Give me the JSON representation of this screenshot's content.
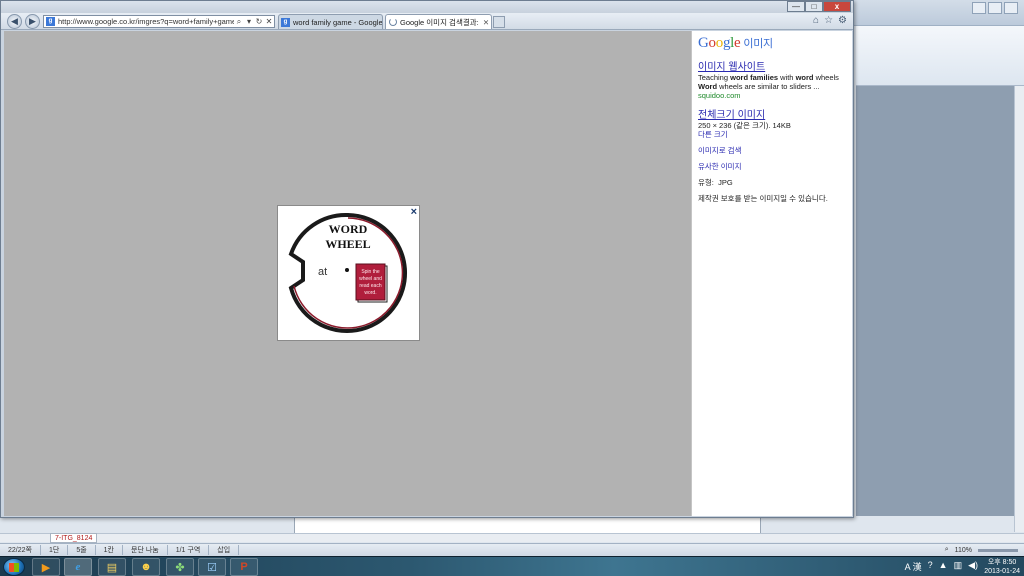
{
  "browser": {
    "address_url": "http://www.google.co.kr/imgres?q=word+family+game&hl=ko",
    "tabs": [
      {
        "label": "word family game - Google ..."
      },
      {
        "label": "Google 이미지 검색결과: h..."
      }
    ],
    "window_buttons": {
      "minimize": "—",
      "maximize": "□",
      "close": "x"
    }
  },
  "preview": {
    "close_label": "×",
    "image_title_line1": "WORD",
    "image_title_line2": "WHEEL",
    "image_word_part": "at",
    "image_card_text": [
      "Spin the",
      "wheel and",
      "read each",
      "word."
    ]
  },
  "panel": {
    "logo": "Google",
    "logo_suffix": "이미지",
    "website_link": "이미지 웹사이트",
    "description_parts": [
      "Teaching ",
      "word families",
      " with ",
      "word",
      " wheels"
    ],
    "description_line2_parts": [
      "Word",
      " wheels are similar to sliders ..."
    ],
    "site": "squidoo.com",
    "fullsize_link": "전체크기 이미지",
    "image_info": "250 × 236 (같은 크기). 14KB",
    "other_sizes": "다른 크기",
    "search_by_image": "이미지로 검색",
    "similar_images": "유사한 이미지",
    "type_label": "유형:",
    "type_value": "JPG",
    "copyright": "제작권 보호를 받는 이미지일 수 있습니다."
  },
  "background_app": {
    "sheet_tab": "7-ITG_8124",
    "status_items": [
      "22/22쪽",
      "1단",
      "5줄",
      "1칸",
      "문단 나눔",
      "1/1 구역",
      "삽입"
    ],
    "zoom": "110%"
  },
  "taskbar": {
    "clock_period": "오후 8:50",
    "clock_date": "2013-01-24",
    "ime": "A 漢"
  },
  "colors": {
    "overlay_gray": "#b2b2b2",
    "google_link": "#2a2ab0",
    "site_green": "#1f8a2b",
    "wheel_maroon": "#8b1a2b"
  }
}
